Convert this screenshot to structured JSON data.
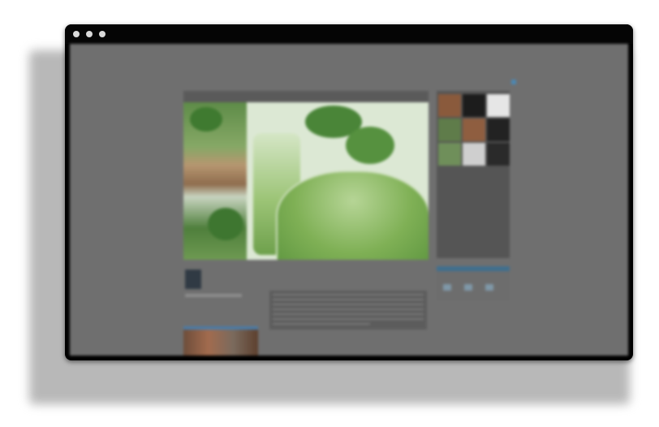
{
  "nav": {
    "links": [
      "",
      "",
      "",
      ""
    ]
  },
  "breadcrumb": "",
  "post": {
    "title": "",
    "date": ""
  },
  "author": {
    "link": ""
  },
  "colors": {
    "window_chrome": "#000000",
    "page_background": "#6f6f6f",
    "accent_orange": "#b07a3f",
    "accent_blue": "#3f6f8f"
  },
  "icons": {
    "window_controls": [
      "close-dot",
      "minimize-dot",
      "maximize-dot"
    ],
    "share": "share-icon"
  }
}
